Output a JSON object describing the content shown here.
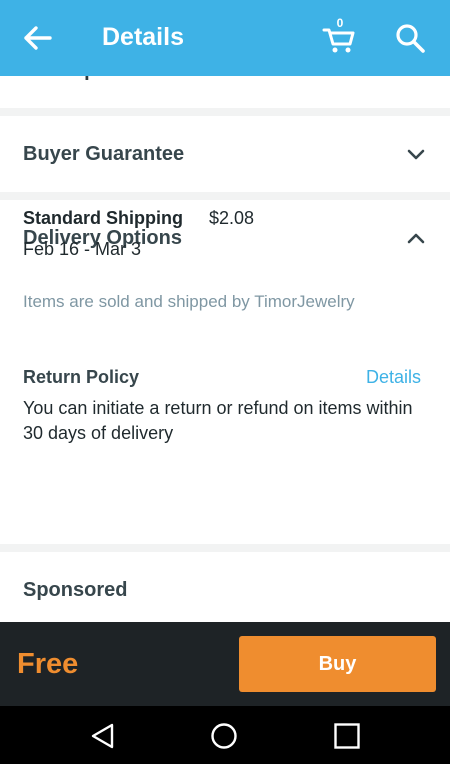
{
  "header": {
    "title": "Details",
    "cart_count": "0",
    "back_icon": "arrow-left-icon",
    "cart_icon": "shopping-cart-icon",
    "search_icon": "search-icon",
    "background_color": "#3eb2e6"
  },
  "sections": {
    "description": {
      "title": "Description"
    },
    "buyer_guarantee": {
      "title": "Buyer Guarantee",
      "icon": "chevron-down-icon"
    },
    "delivery_options": {
      "title": "Delivery Options",
      "icon": "chevron-up-icon",
      "shipping_label": "Standard Shipping",
      "shipping_price": "$2.08",
      "dates": "Feb 16 - Mar 3",
      "sold_by": "Items are sold and shipped by TimorJewelry",
      "return_policy": {
        "title": "Return Policy",
        "link": "Details",
        "text": "You can initiate a return or refund on items within 30 days of delivery"
      }
    },
    "sponsored": {
      "title": "Sponsored"
    }
  },
  "footer": {
    "price": "Free",
    "buy_label": "Buy",
    "accent_color": "#ef8d2f"
  },
  "system_nav": {
    "back_icon": "nav-back-triangle-icon",
    "home_icon": "nav-home-circle-icon",
    "recents_icon": "nav-recents-square-icon"
  }
}
